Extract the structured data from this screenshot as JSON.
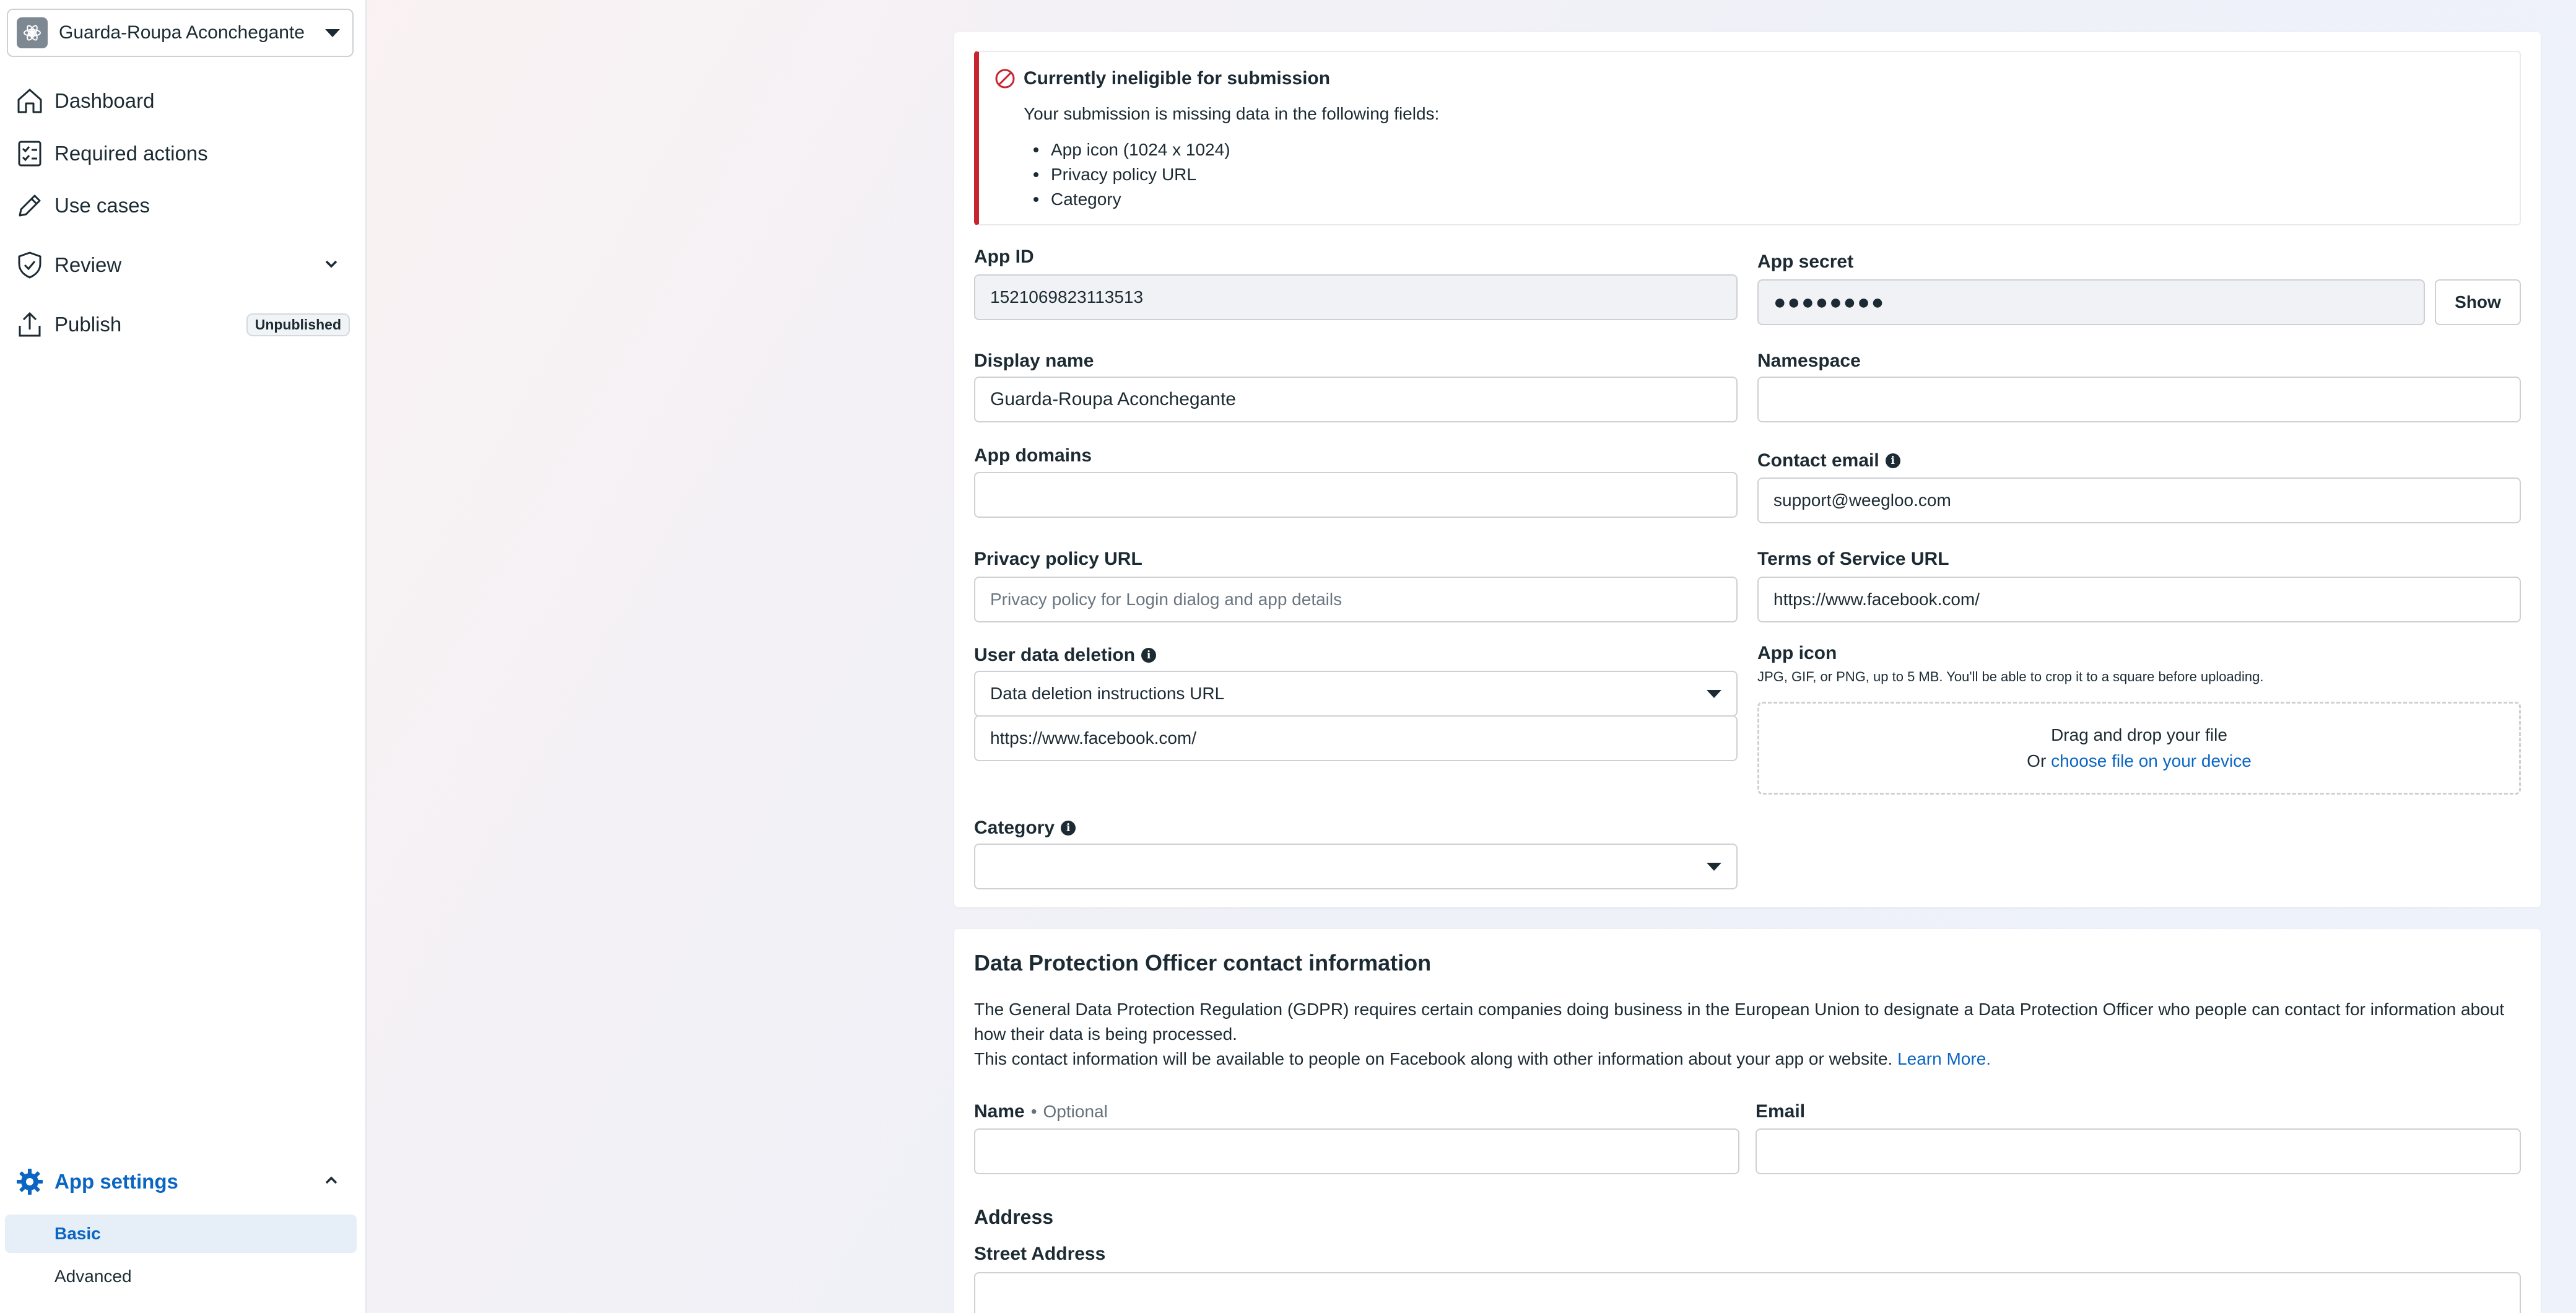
{
  "sidebar": {
    "app_name": "Guarda-Roupa Aconchegante",
    "items": [
      {
        "label": "Dashboard"
      },
      {
        "label": "Required actions"
      },
      {
        "label": "Use cases"
      },
      {
        "label": "Review"
      },
      {
        "label": "Publish",
        "badge": "Unpublished"
      }
    ],
    "settings": {
      "label": "App settings",
      "children": [
        {
          "label": "Basic",
          "active": true
        },
        {
          "label": "Advanced"
        }
      ]
    }
  },
  "alert": {
    "title": "Currently ineligible for submission",
    "text": "Your submission is missing data in the following fields:",
    "missing": [
      "App icon (1024 x 1024)",
      "Privacy policy URL",
      "Category"
    ]
  },
  "form": {
    "app_id": {
      "label": "App ID",
      "value": "1521069823113513"
    },
    "app_secret": {
      "label": "App secret",
      "value": "●●●●●●●●",
      "button": "Show"
    },
    "display_name": {
      "label": "Display name",
      "value": "Guarda-Roupa Aconchegante"
    },
    "namespace": {
      "label": "Namespace",
      "value": ""
    },
    "app_domains": {
      "label": "App domains",
      "value": ""
    },
    "contact_email": {
      "label": "Contact email",
      "value": "support@weegloo.com"
    },
    "privacy_policy": {
      "label": "Privacy policy URL",
      "placeholder": "Privacy policy for Login dialog and app details"
    },
    "terms_of_service": {
      "label": "Terms of Service URL",
      "value": "https://www.facebook.com/"
    },
    "user_data_deletion": {
      "label": "User data deletion",
      "selected": "Data deletion instructions URL",
      "url": "https://www.facebook.com/"
    },
    "app_icon": {
      "label": "App icon",
      "hint": "JPG, GIF, or PNG, up to 5 MB. You'll be able to crop it to a square before uploading.",
      "drop_text": "Drag and drop your file",
      "or_text": "Or",
      "choose_link": "choose file on your device"
    },
    "category": {
      "label": "Category",
      "selected": ""
    }
  },
  "dpo": {
    "title": "Data Protection Officer contact information",
    "para1": "The General Data Protection Regulation (GDPR) requires certain companies doing business in the European Union to designate a Data Protection Officer who people can contact for information about how their data is being processed.",
    "para2": "This contact information will be available to people on Facebook along with other information about your app or website.",
    "learn_more": "Learn More.",
    "name_label": "Name",
    "optional": "Optional",
    "email_label": "Email",
    "address_heading": "Address",
    "street_label": "Street Address"
  },
  "colors": {
    "accent": "#0a66c2",
    "error": "#c8242f"
  }
}
